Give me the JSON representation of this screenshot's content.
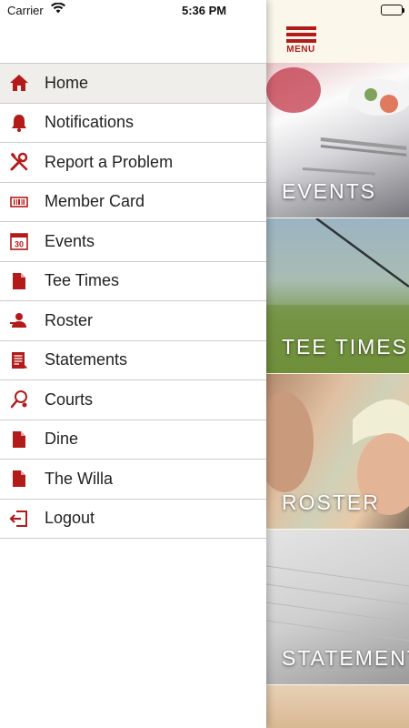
{
  "status_bar": {
    "carrier": "Carrier",
    "time": "5:36 PM"
  },
  "colors": {
    "accent": "#b31b1b",
    "active_row": "#f0eeea",
    "divider": "#cccccc"
  },
  "menu": {
    "items": [
      {
        "label": "Home",
        "icon": "home-icon",
        "active": true
      },
      {
        "label": "Notifications",
        "icon": "bell-icon"
      },
      {
        "label": "Report a Problem",
        "icon": "tools-icon"
      },
      {
        "label": "Member Card",
        "icon": "barcode-card-icon"
      },
      {
        "label": "Events",
        "icon": "calendar-icon",
        "icon_text": "30"
      },
      {
        "label": "Tee Times",
        "icon": "document-icon"
      },
      {
        "label": "Roster",
        "icon": "roster-person-icon"
      },
      {
        "label": "Statements",
        "icon": "statement-icon"
      },
      {
        "label": "Courts",
        "icon": "tennis-racket-icon"
      },
      {
        "label": "Dine",
        "icon": "document-icon"
      },
      {
        "label": "The Willa",
        "icon": "document-icon"
      },
      {
        "label": "Logout",
        "icon": "logout-icon"
      }
    ]
  },
  "content": {
    "menu_button_label": "MENU",
    "tiles": [
      {
        "label": "EVENTS"
      },
      {
        "label": "TEE TIMES"
      },
      {
        "label": "ROSTER"
      },
      {
        "label": "STATEMENTS"
      }
    ]
  }
}
